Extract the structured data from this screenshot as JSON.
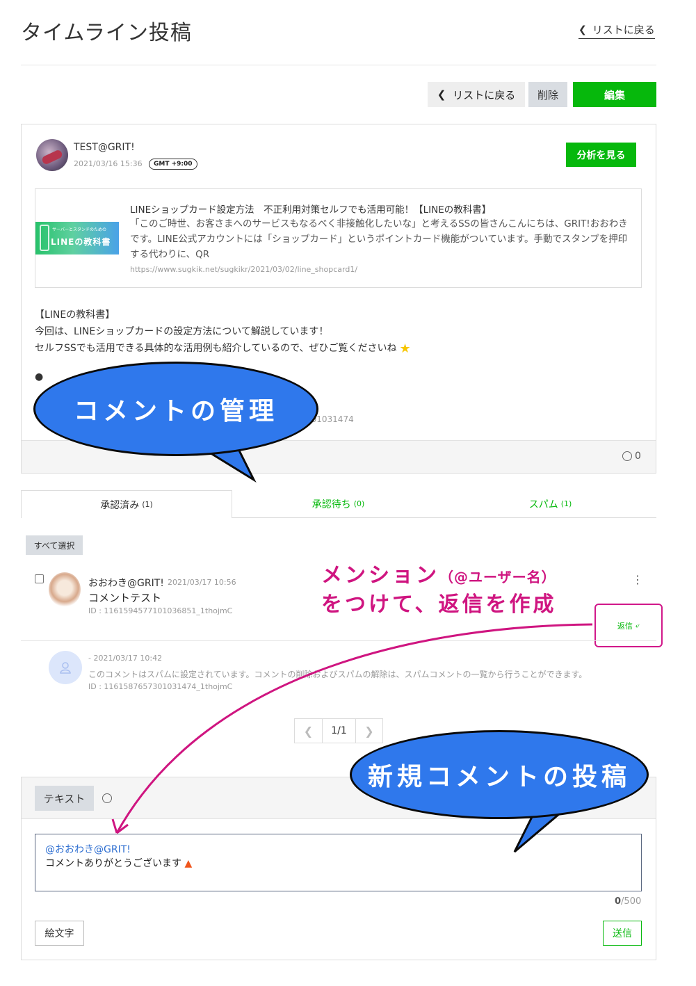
{
  "header": {
    "title": "タイムライン投稿",
    "back_link": "リストに戻る"
  },
  "toolbar": {
    "back_label": "リストに戻る",
    "delete_label": "削除",
    "edit_label": "編集"
  },
  "post": {
    "account_name": "TEST@GRIT!",
    "date": "2021/03/16 15:36",
    "timezone": "GMT +9:00",
    "analyze_label": "分析を見る",
    "link_card": {
      "thumb_small": "サーバーとスタンドのための",
      "thumb_big": "LINEの教科書",
      "title": "LINEショップカード設定方法　不正利用対策セルフでも活用可能！【LINEの教科書】",
      "description": "「このご時世、お客さまへのサービスもなるべく非接触化したいな」と考えるSSの皆さんこんにちは、GRIT!おおわきです。LINE公式アカウントには「ショップカード」というポイントカード機能がついています。手動でスタンプを押印する代わりに、QR",
      "url": "https://www.sugkik.net/sugkikr/2021/03/02/line_shopcard1/"
    },
    "body_line1": "【LINEの教科書】",
    "body_line2": "今回は、LINEショップカードの設定方法について解説しています！",
    "body_line3": "セルフSSでも活用できる具体的な活用例も紹介しているので、ぜひご覧くださいね",
    "hidden_id": "301031474",
    "reaction_count": "0"
  },
  "tabs": [
    {
      "label": "承認済み",
      "count": "(1)"
    },
    {
      "label": "承認待ち",
      "count": "(0)"
    },
    {
      "label": "スパム",
      "count": "(1)"
    }
  ],
  "select_all_label": "すべて選択",
  "comments": [
    {
      "author": "おおわき@GRIT!",
      "date": "2021/03/17 10:56",
      "text": "コメントテスト",
      "id": "ID : 1161594577101036851_1thojmC",
      "reply_label": "返信"
    }
  ],
  "spam_comment": {
    "date": "- 2021/03/17 10:42",
    "message": "このコメントはスパムに設定されています。コメントの削除およびスパムの解除は、スパムコメントの一覧から行うことができます。",
    "id": "ID : 1161587657301031474_1thojmC"
  },
  "pagination": {
    "label": "1/1"
  },
  "composer": {
    "tab_text": "テキスト",
    "mention": "@おおわき@GRIT!",
    "message": "コメントありがとうございます",
    "counter_current": "0",
    "counter_max": "/500",
    "emoji_button": "絵文字",
    "send_button": "送信"
  },
  "annotations": {
    "bubble_comment_manage": "コメントの管理",
    "bubble_new_comment": "新規コメントの投稿",
    "mention_line1": "メンション",
    "mention_line1_small": "（@ユーザー名）",
    "mention_line2": "をつけて、返信を作成"
  },
  "colors": {
    "accent_green": "#06b80c",
    "annotation_blue": "#2f78ec",
    "annotation_magenta": "#cf1580"
  }
}
